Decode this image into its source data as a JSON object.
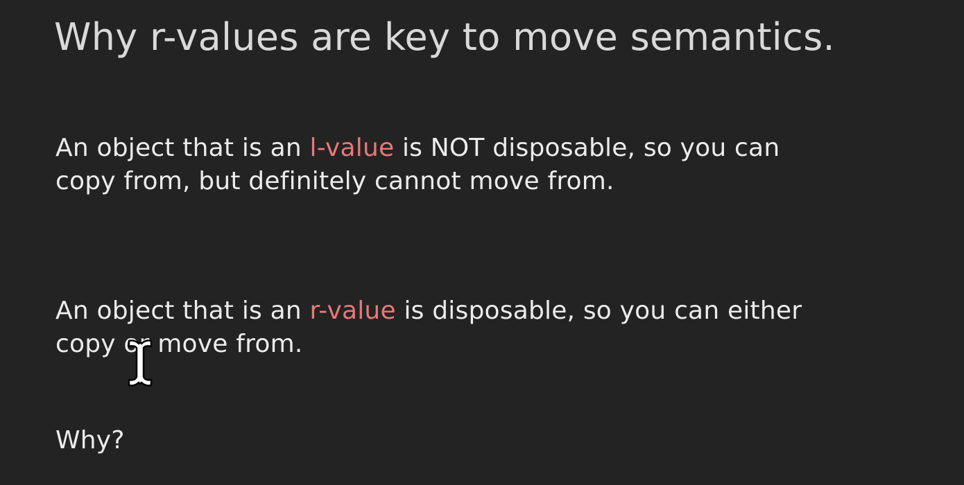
{
  "slide": {
    "title": "Why r-values are key to move semantics.",
    "paragraphs": [
      {
        "line1_before": "An object that is an ",
        "highlight": "l-value",
        "line1_after": " is NOT disposable, so you can",
        "line2": "copy from, but definitely cannot move from."
      },
      {
        "line1_before": "An object that is an ",
        "highlight": "r-value",
        "line1_after": " is disposable, so you can either",
        "line2": "copy or move from."
      },
      {
        "text": "Why?"
      }
    ],
    "highlight_color": "#e8787a",
    "background_color": "#232323"
  },
  "cursor": {
    "icon": "text-cursor-icon"
  }
}
